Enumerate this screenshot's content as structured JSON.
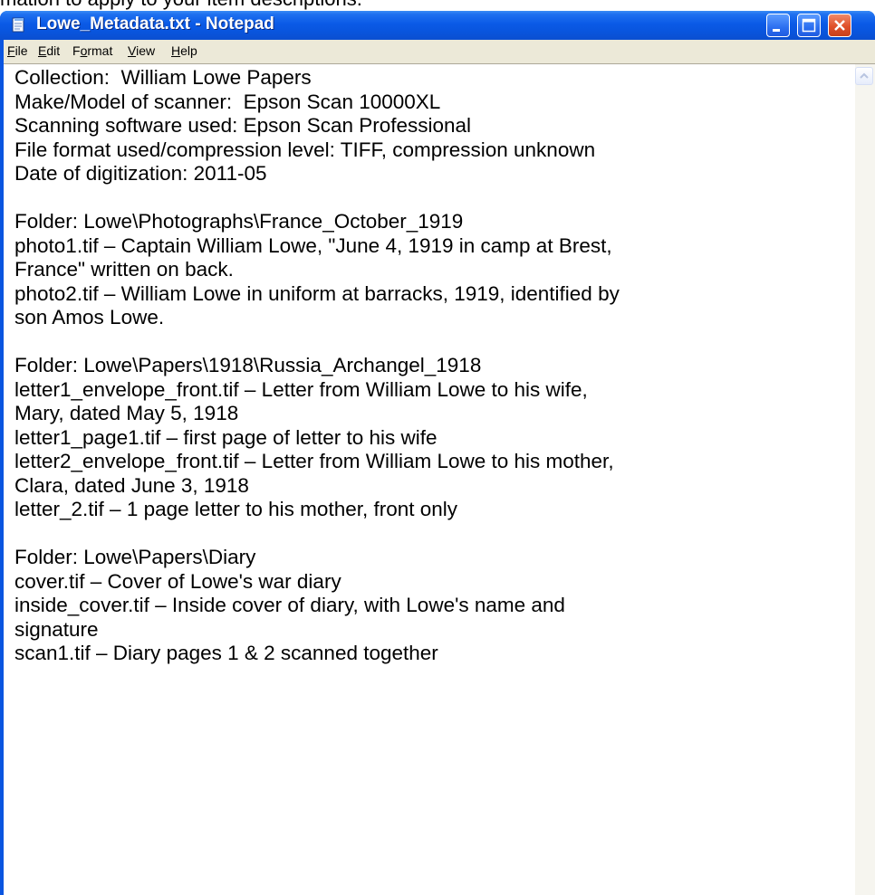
{
  "background_text": "mation to apply to your item descriptions.",
  "window": {
    "title": "Lowe_Metadata.txt - Notepad",
    "accent_color": "#0a55e0",
    "controls": {
      "minimize": "minimize-icon",
      "maximize": "maximize-icon",
      "close": "close-icon"
    }
  },
  "menu": {
    "items": [
      {
        "first": "F",
        "rest": "ile"
      },
      {
        "first": "E",
        "rest": "dit"
      },
      {
        "pre": "F",
        "first": "o",
        "rest": "rmat"
      },
      {
        "first": "V",
        "rest": "iew"
      },
      {
        "first": "H",
        "rest": "elp"
      }
    ]
  },
  "document": {
    "lines": [
      "Collection:  William Lowe Papers",
      "Make/Model of scanner:  Epson Scan 10000XL",
      "Scanning software used: Epson Scan Professional",
      "File format used/compression level: TIFF, compression unknown",
      "Date of digitization: 2011-05",
      "",
      "Folder: Lowe\\Photographs\\France_October_1919",
      "photo1.tif – Captain William Lowe, \"June 4, 1919 in camp at Brest,",
      "France\" written on back.",
      "photo2.tif – William Lowe in uniform at barracks, 1919, identified by",
      "son Amos Lowe.",
      "",
      "Folder: Lowe\\Papers\\1918\\Russia_Archangel_1918",
      "letter1_envelope_front.tif – Letter from William Lowe to his wife,",
      "Mary, dated May 5, 1918",
      "letter1_page1.tif – first page of letter to his wife",
      "letter2_envelope_front.tif – Letter from William Lowe to his mother,",
      "Clara, dated June 3, 1918",
      "letter_2.tif – 1 page letter to his mother, front only",
      "",
      "Folder: Lowe\\Papers\\Diary",
      "cover.tif – Cover of Lowe's war diary",
      "inside_cover.tif – Inside cover of diary, with Lowe's name and",
      "signature",
      "scan1.tif – Diary pages 1 & 2 scanned together"
    ]
  }
}
